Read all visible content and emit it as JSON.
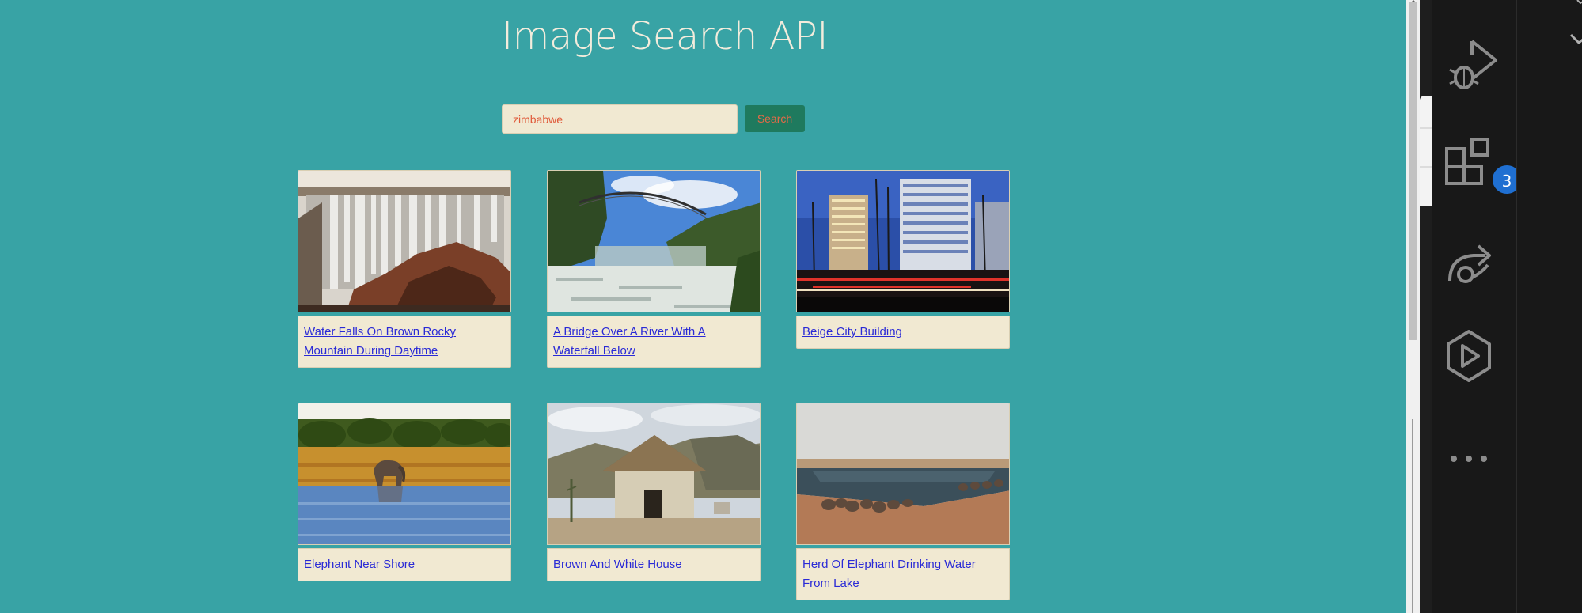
{
  "page": {
    "title": "Image Search API"
  },
  "search": {
    "value": "zimbabwe",
    "button_label": "Search"
  },
  "results": [
    {
      "caption": "Water Falls On Brown Rocky Mountain During Daytime"
    },
    {
      "caption": "A Bridge Over A River With A Waterfall Below"
    },
    {
      "caption": "Beige City Building"
    },
    {
      "caption": "Elephant Near Shore"
    },
    {
      "caption": "Brown And White House"
    },
    {
      "caption": "Herd Of Elephant Drinking Water From Lake"
    }
  ],
  "activity_bar": {
    "icons": [
      "run-and-debug-icon",
      "extensions-icon",
      "remote-explorer-icon",
      "live-share-icon",
      "more-icon"
    ],
    "extensions_badge": "3"
  },
  "colors": {
    "page_background": "#38a3a5",
    "title": "#f3ecdc",
    "card_background": "#f1e9d2",
    "link": "#2a2ad6",
    "search_button": "#1f7a5e",
    "search_text": "#e05a3a",
    "activity_bar": "#181818",
    "badge": "#1f6fd1"
  }
}
